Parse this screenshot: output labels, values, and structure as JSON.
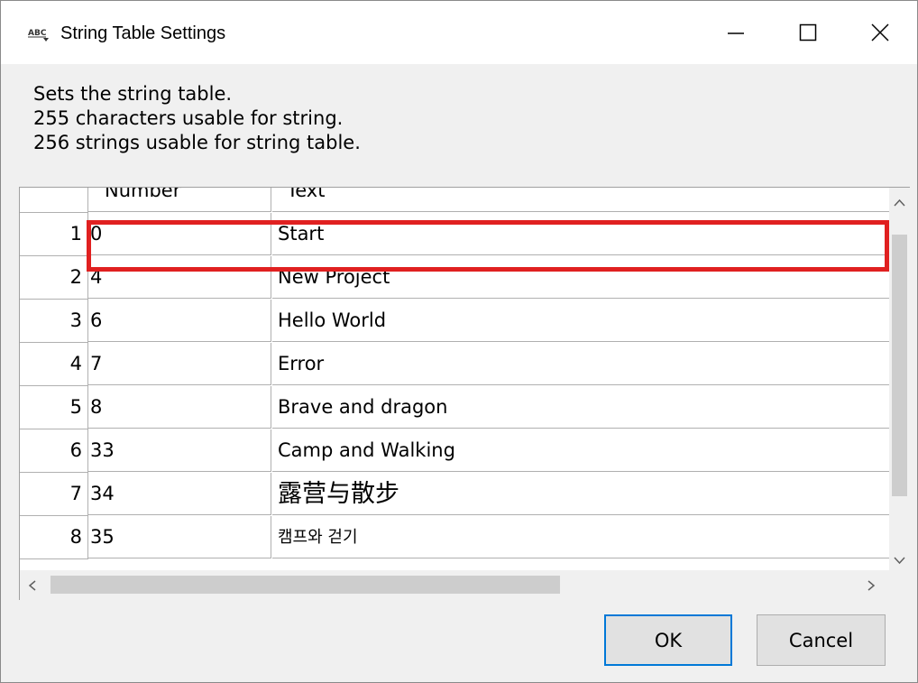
{
  "window": {
    "title": "String Table Settings",
    "icon": "abc-icon"
  },
  "description": {
    "lines": [
      "Sets the string table.",
      "255 characters usable for string.",
      "256 strings usable for string table."
    ]
  },
  "table": {
    "headers": {
      "index": "",
      "number": "Number",
      "text": "Text"
    },
    "rows": [
      {
        "index": "1",
        "number": "0",
        "text": "Start"
      },
      {
        "index": "2",
        "number": "4",
        "text": "New Project"
      },
      {
        "index": "3",
        "number": "6",
        "text": "Hello World"
      },
      {
        "index": "4",
        "number": "7",
        "text": "Error"
      },
      {
        "index": "5",
        "number": "8",
        "text": "Brave and dragon"
      },
      {
        "index": "6",
        "number": "33",
        "text": "Camp and Walking"
      },
      {
        "index": "7",
        "number": "34",
        "text": "露营与散步"
      },
      {
        "index": "8",
        "number": "35",
        "text": "캠프와 걷기"
      }
    ],
    "highlight_color": "#e02020"
  },
  "buttons": {
    "ok_label": "OK",
    "cancel_label": "Cancel"
  },
  "colors": {
    "accent": "#0078d7"
  }
}
